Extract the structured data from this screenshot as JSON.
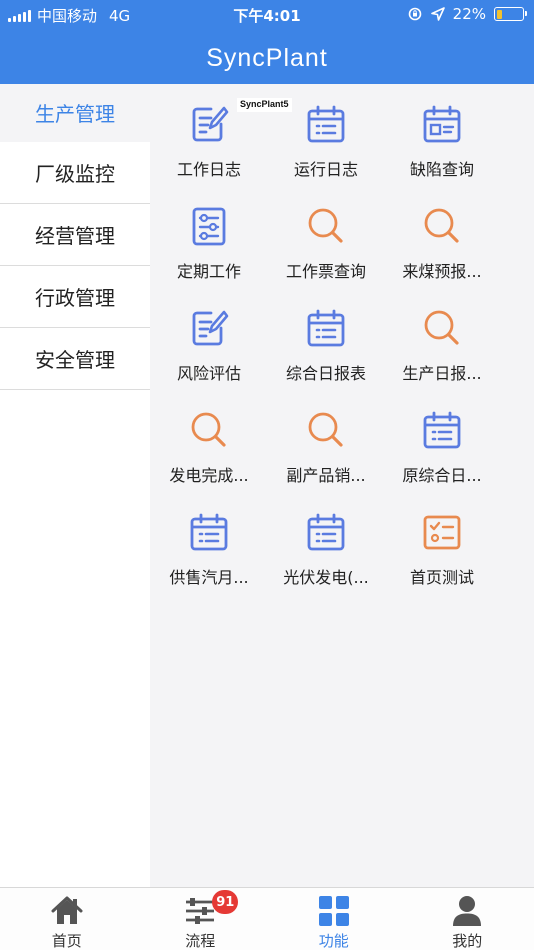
{
  "status": {
    "carrier": "中国移动",
    "network": "4G",
    "time": "下午4:01",
    "battery_percent_text": "22%",
    "battery_level": 0.22
  },
  "app": {
    "title": "SyncPlant"
  },
  "stamp": "SyncPlant5",
  "sidebar": {
    "items": [
      {
        "label": "生产管理",
        "active": true
      },
      {
        "label": "厂级监控"
      },
      {
        "label": "经营管理"
      },
      {
        "label": "行政管理"
      },
      {
        "label": "安全管理"
      }
    ]
  },
  "grid": {
    "items": [
      {
        "label": "工作日志",
        "icon": "edit-doc-icon"
      },
      {
        "label": "运行日志",
        "icon": "calendar-icon"
      },
      {
        "label": "缺陷查询",
        "icon": "id-card-icon"
      },
      {
        "label": "定期工作",
        "icon": "sliders-doc-icon"
      },
      {
        "label": "工作票查询",
        "icon": "search-icon"
      },
      {
        "label": "来煤预报...",
        "icon": "search-icon"
      },
      {
        "label": "风险评估",
        "icon": "edit-doc-icon"
      },
      {
        "label": "综合日报表",
        "icon": "calendar-icon"
      },
      {
        "label": "生产日报...",
        "icon": "search-icon"
      },
      {
        "label": "发电完成...",
        "icon": "search-icon"
      },
      {
        "label": "副产品销...",
        "icon": "search-icon"
      },
      {
        "label": "原综合日...",
        "icon": "calendar-icon"
      },
      {
        "label": "供售汽月...",
        "icon": "calendar-icon"
      },
      {
        "label": "光伏发电(...",
        "icon": "calendar-icon"
      },
      {
        "label": "首页测试",
        "icon": "checklist-icon"
      }
    ]
  },
  "colors": {
    "accent": "#3d84e6",
    "icon_blue": "#5a7be0",
    "icon_orange": "#e88a4f",
    "badge": "#e53935"
  },
  "tabbar": {
    "items": [
      {
        "label": "首页",
        "icon": "home-icon"
      },
      {
        "label": "流程",
        "icon": "sliders-icon",
        "badge": "91"
      },
      {
        "label": "功能",
        "icon": "grid-icon",
        "active": true
      },
      {
        "label": "我的",
        "icon": "user-icon"
      }
    ]
  }
}
